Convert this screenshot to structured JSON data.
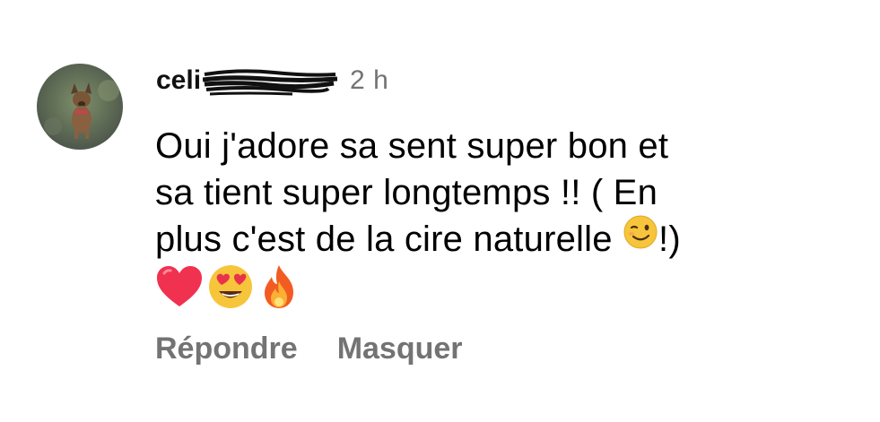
{
  "comment": {
    "username_visible": "celi",
    "time": "2 h",
    "text_lines": [
      "Oui j'adore sa sent super bon et",
      "sa tient super longtemps !! ( En",
      "plus c'est de la cire naturelle",
      "!)"
    ],
    "emoji_inline": "winking-face",
    "emoji_row": [
      "red-heart",
      "smiling-face-with-heart-eyes",
      "fire"
    ]
  },
  "actions": {
    "reply_label": "Répondre",
    "hide_label": "Masquer"
  },
  "colors": {
    "secondary_text": "#737373",
    "primary_text": "#000000",
    "background": "#ffffff"
  }
}
